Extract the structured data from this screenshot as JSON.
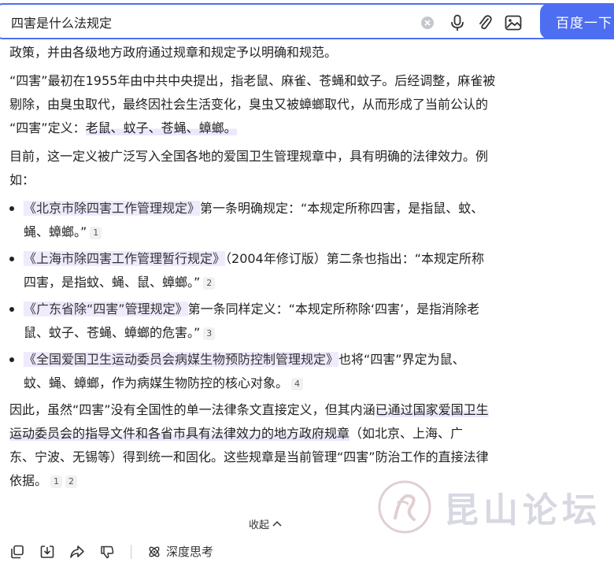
{
  "search": {
    "query": "四害是什么法规定",
    "button_label": "百度一下"
  },
  "answer": {
    "p0_line2": "政策，并由各级地方政府通过规章和规定予以明确和规范。",
    "p1": [
      "“四害”最初在1955年由中共中央提出，指老鼠、麻雀、苍蝇和蚊子。后经调整，麻雀被",
      "剔除，由臭虫取代，最终因社会生活变化，臭虫又被蟑螂取代，从而形成了当前公认的",
      "“四害”定义："
    ],
    "p1_highlight": "老鼠、蚊子、苍蝇、蟑螂。",
    "p2": [
      "目前，这一定义被广泛写入全国各地的爱国卫生管理规章中，具有明确的法律效力。例",
      "如："
    ],
    "bullets": [
      {
        "doc": "《北京市除四害工作管理规定》",
        "rest1": "第一条明确规定：“本规定所称四害，是指鼠、蚊、",
        "rest2": "蝇、蟑螂。”",
        "cite": "1"
      },
      {
        "doc": "《上海市除四害工作管理暂行规定》",
        "rest1": "（2004年修订版）第二条也指出：“本规定所称",
        "rest2": "四害，是指蚊、蝇、鼠、蟑螂。”",
        "cite": "2"
      },
      {
        "doc": "《广东省除“四害”管理规定》",
        "rest1": "第一条同样定义：“本规定所称除‘四害’，是指消除老",
        "rest2": "鼠、蚊子、苍蝇、蟑螂的危害。”",
        "cite": "3"
      },
      {
        "doc": "《全国爱国卫生运动委员会病媒生物预防控制管理规定》",
        "rest1": "也将“四害”界定为鼠、",
        "rest2": "蚊、蝇、蟑螂，作为病媒生物防控的核心对象。",
        "cite": "4"
      }
    ],
    "p3_l1a": "因此，虽然“四害”没有全国性的单一法律条文直接定义，但其内涵",
    "p3_l1b": "已通过国家爱国卫生",
    "p3_l2a": "运动委员会的指导文件和各省市具有法律效力的地方政府规章",
    "p3_l2b": "（如北京、上海、广",
    "p3_l3": "东、宁波、无锡等）得到统一和固化。这些规章是当前管理“四害”防治工作的直接法律",
    "p3_l4": "依据。",
    "p3_cites": [
      "1",
      "2"
    ]
  },
  "collapse_label": "收起",
  "actions": {
    "deep_think_label": "深度思考"
  },
  "watermark": {
    "text": "昆山论坛"
  },
  "colors": {
    "accent": "#4e6ef2",
    "highlight": "#ece7fb"
  }
}
